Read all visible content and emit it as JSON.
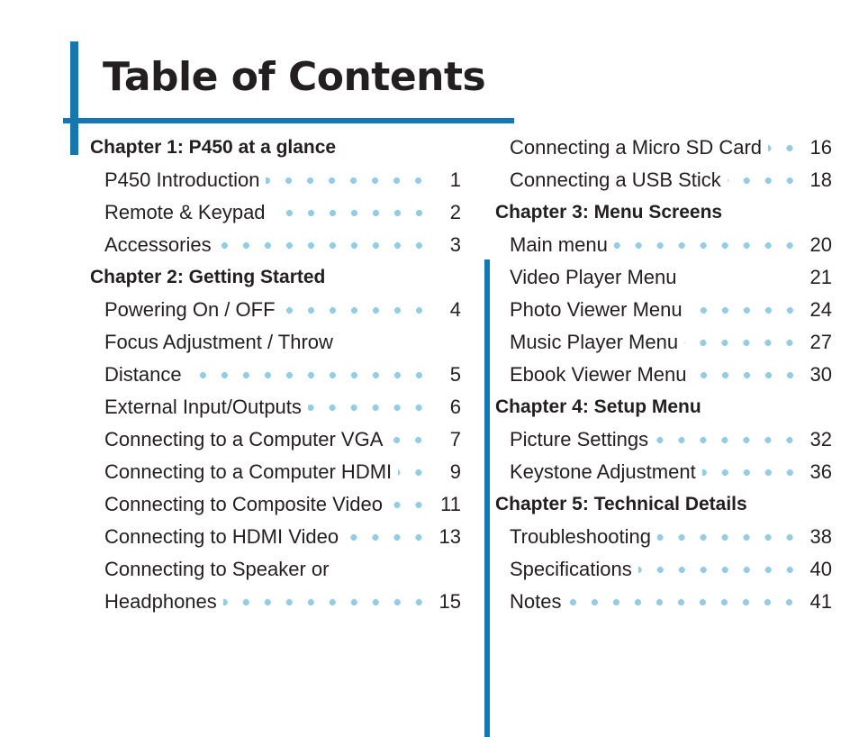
{
  "document": {
    "title": "Table of Contents"
  },
  "colors": {
    "accent_blue": "#1577b0",
    "leader_dot_blue": "#92cde4",
    "text": "#231f20"
  },
  "left_column": [
    {
      "type": "chapter",
      "label": "Chapter 1: P450 at a glance"
    },
    {
      "type": "entry",
      "label": "P450 Introduction",
      "page": "1",
      "leader": true
    },
    {
      "type": "entry",
      "label": "Remote & Keypad",
      "page": "2",
      "leader": true
    },
    {
      "type": "entry",
      "label": "Accessories",
      "page": "3",
      "leader": true
    },
    {
      "type": "chapter",
      "label": "Chapter 2: Getting Started"
    },
    {
      "type": "entry",
      "label": "Powering On / OFF",
      "page": "4",
      "leader": true
    },
    {
      "type": "entry",
      "label": "Focus Adjustment / Throw",
      "page": "",
      "leader": false
    },
    {
      "type": "entry",
      "label": "Distance",
      "page": "5",
      "leader": true
    },
    {
      "type": "entry",
      "label": "External Input/Outputs",
      "page": "6",
      "leader": true
    },
    {
      "type": "entry",
      "label": "Connecting to a Computer VGA",
      "page": "7",
      "leader": true
    },
    {
      "type": "entry",
      "label": "Connecting to a Computer HDMI",
      "page": "9",
      "leader": true
    },
    {
      "type": "entry",
      "label": "Connecting to Composite Video",
      "page": "11",
      "leader": true
    },
    {
      "type": "entry",
      "label": "Connecting to HDMI Video",
      "page": "13",
      "leader": true
    },
    {
      "type": "entry",
      "label": "Connecting to Speaker or",
      "page": "",
      "leader": false
    },
    {
      "type": "entry",
      "label": "Headphones",
      "page": "15",
      "leader": true
    }
  ],
  "right_column": [
    {
      "type": "entry",
      "label": "Connecting a Micro SD Card",
      "page": "16",
      "leader": true
    },
    {
      "type": "entry",
      "label": "Connecting a USB Stick",
      "page": "18",
      "leader": true
    },
    {
      "type": "chapter",
      "label": "Chapter 3: Menu Screens"
    },
    {
      "type": "entry",
      "label": "Main menu",
      "page": "20",
      "leader": true
    },
    {
      "type": "entry",
      "label": "Video Player Menu",
      "page": "21",
      "leader": false
    },
    {
      "type": "entry",
      "label": "Photo Viewer Menu",
      "page": "24",
      "leader": true
    },
    {
      "type": "entry",
      "label": "Music Player Menu",
      "page": "27",
      "leader": true
    },
    {
      "type": "entry",
      "label": "Ebook Viewer Menu",
      "page": "30",
      "leader": true
    },
    {
      "type": "chapter",
      "label": "Chapter 4: Setup Menu"
    },
    {
      "type": "entry",
      "label": "Picture Settings",
      "page": "32",
      "leader": true
    },
    {
      "type": "entry",
      "label": "Keystone Adjustment",
      "page": "36",
      "leader": true
    },
    {
      "type": "chapter",
      "label": "Chapter 5: Technical Details"
    },
    {
      "type": "entry",
      "label": "Troubleshooting",
      "page": "38",
      "leader": true
    },
    {
      "type": "entry",
      "label": "Specifications",
      "page": "40",
      "leader": true
    },
    {
      "type": "entry",
      "label": "Notes",
      "page": "41",
      "leader": true
    }
  ]
}
